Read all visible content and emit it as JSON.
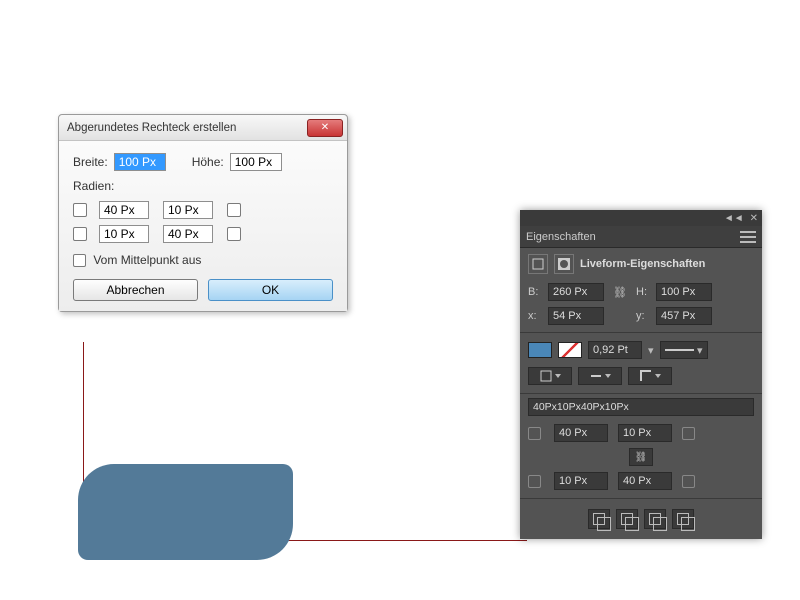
{
  "dialog": {
    "title": "Abgerundetes Rechteck erstellen",
    "width_label": "Breite:",
    "width_value": "100 Px",
    "height_label": "Höhe:",
    "height_value": "100 Px",
    "radii_label": "Radien:",
    "r_tl": "40 Px",
    "r_tr": "10 Px",
    "r_bl": "10 Px",
    "r_br": "40 Px",
    "midpoint_label": "Vom Mittelpunkt aus",
    "cancel": "Abbrechen",
    "ok": "OK"
  },
  "panel": {
    "tab": "Eigenschaften",
    "heading": "Liveform-Eigenschaften",
    "b_label": "B:",
    "b_value": "260 Px",
    "h_label": "H:",
    "h_value": "100 Px",
    "x_label": "x:",
    "x_value": "54 Px",
    "y_label": "y:",
    "y_value": "457 Px",
    "stroke_w": "0,92 Pt",
    "rad_summary": "40Px10Px40Px10Px",
    "r_tl": "40 Px",
    "r_tr": "10 Px",
    "r_bl": "10 Px",
    "r_br": "40 Px"
  },
  "colors": {
    "shape": "#537a98"
  }
}
